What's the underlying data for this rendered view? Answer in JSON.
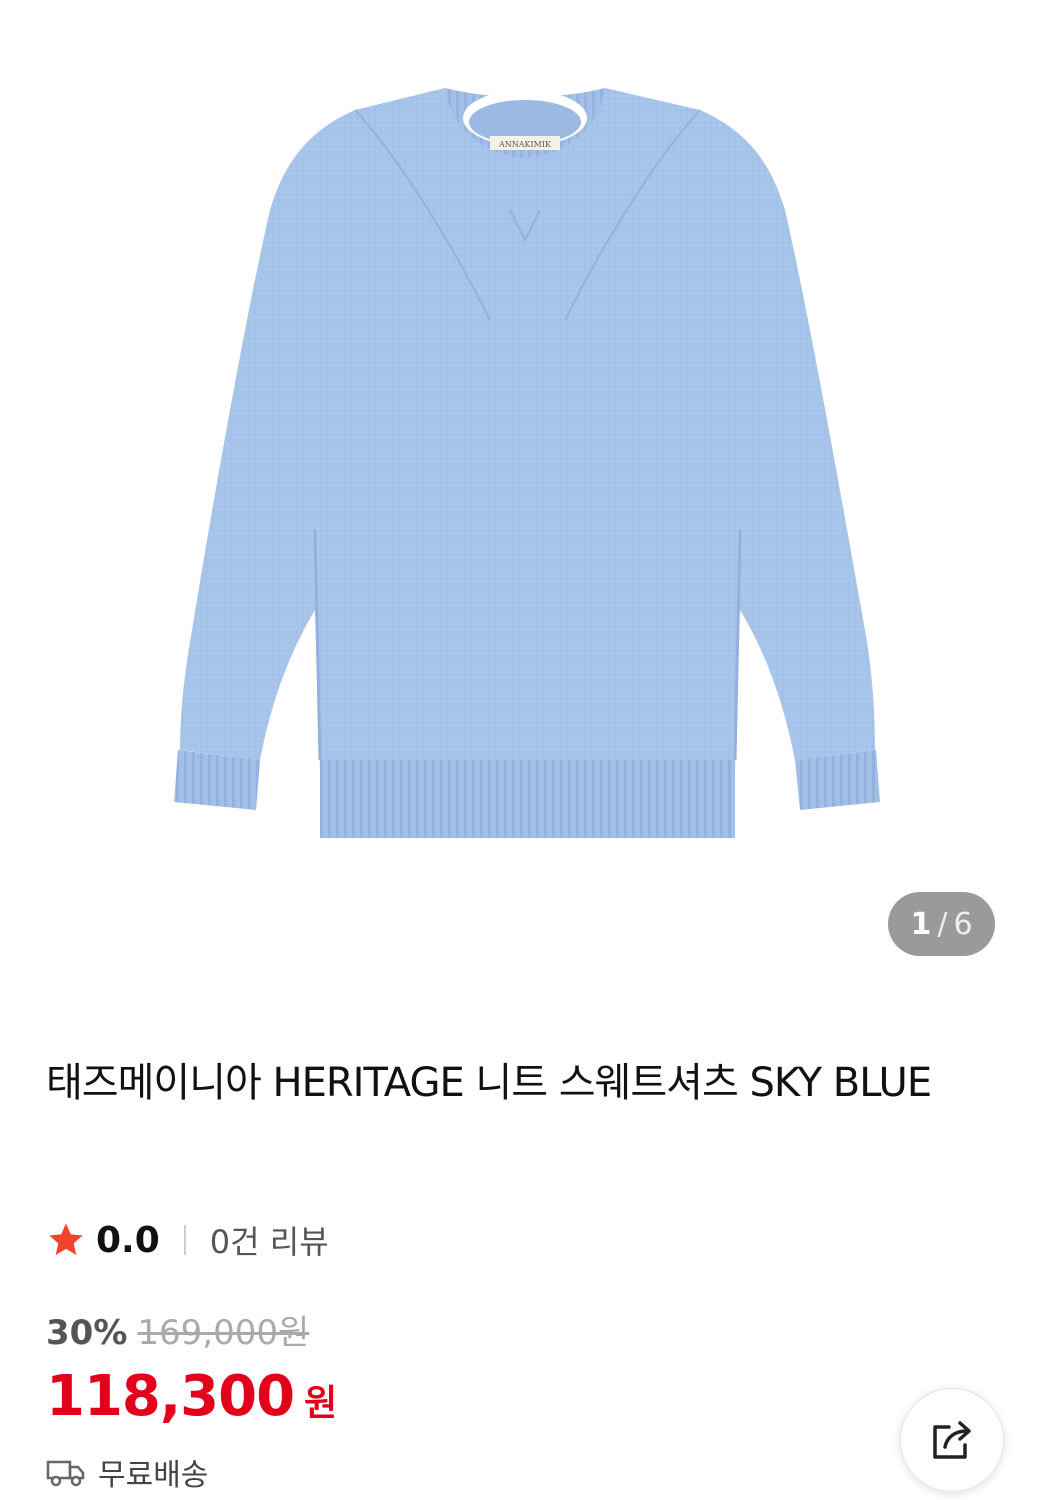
{
  "gallery": {
    "current": "1",
    "separator": "/",
    "total": "6",
    "image_icon": "sweater-product-photo",
    "product_color": "#a6c3ea",
    "label_text": "ANNAKIMIK"
  },
  "product": {
    "title": "태즈메이니아 HERITAGE 니트 스웨트셔츠 SKY BLUE"
  },
  "rating": {
    "star_icon": "star-icon",
    "value": "0.0",
    "review_count": "0건 리뷰",
    "star_color": "#f0422d"
  },
  "price": {
    "discount_rate": "30%",
    "original_price": "169,000원",
    "sale_price": "118,300",
    "currency": "원",
    "sale_color": "#e3001b"
  },
  "shipping": {
    "icon": "truck-icon",
    "label": "무료배송"
  },
  "share": {
    "icon": "share-icon"
  }
}
